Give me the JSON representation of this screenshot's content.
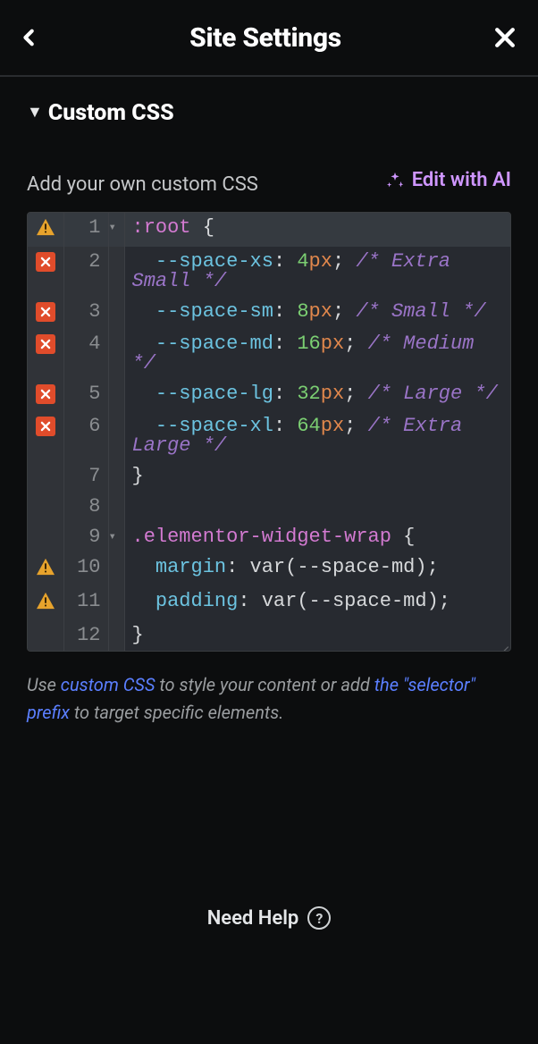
{
  "header": {
    "title": "Site Settings"
  },
  "section": {
    "title": "Custom CSS"
  },
  "subrow": {
    "label": "Add your own custom CSS",
    "edit_ai": "Edit with AI"
  },
  "code": {
    "lines": [
      {
        "n": 1,
        "marker": "warn",
        "fold": true,
        "kind": "sel_open",
        "selector": ":root"
      },
      {
        "n": 2,
        "marker": "err",
        "kind": "decl",
        "prop": "--space-xs",
        "value": "4",
        "unit": "px",
        "comment": "Extra Small"
      },
      {
        "n": 3,
        "marker": "err",
        "kind": "decl",
        "prop": "--space-sm",
        "value": "8",
        "unit": "px",
        "comment": "Small"
      },
      {
        "n": 4,
        "marker": "err",
        "kind": "decl",
        "prop": "--space-md",
        "value": "16",
        "unit": "px",
        "comment": "Medium"
      },
      {
        "n": 5,
        "marker": "err",
        "kind": "decl",
        "prop": "--space-lg",
        "value": "32",
        "unit": "px",
        "comment": "Large"
      },
      {
        "n": 6,
        "marker": "err",
        "kind": "decl",
        "prop": "--space-xl",
        "value": "64",
        "unit": "px",
        "comment": "Extra Large"
      },
      {
        "n": 7,
        "kind": "close"
      },
      {
        "n": 8,
        "kind": "blank"
      },
      {
        "n": 9,
        "fold": true,
        "kind": "sel_open",
        "selector": ".elementor-widget-wrap"
      },
      {
        "n": 10,
        "marker": "warn",
        "kind": "decl2",
        "prop": "margin",
        "func": "var",
        "arg": "--space-md"
      },
      {
        "n": 11,
        "marker": "warn",
        "kind": "decl2",
        "prop": "padding",
        "func": "var",
        "arg": "--space-md"
      },
      {
        "n": 12,
        "kind": "close"
      }
    ]
  },
  "help": {
    "pre": "Use ",
    "link1": "custom CSS",
    "mid": " to style your content or add ",
    "link2": "the \"selector\" prefix",
    "post": " to target specific elements."
  },
  "footer": {
    "need_help": "Need Help"
  }
}
